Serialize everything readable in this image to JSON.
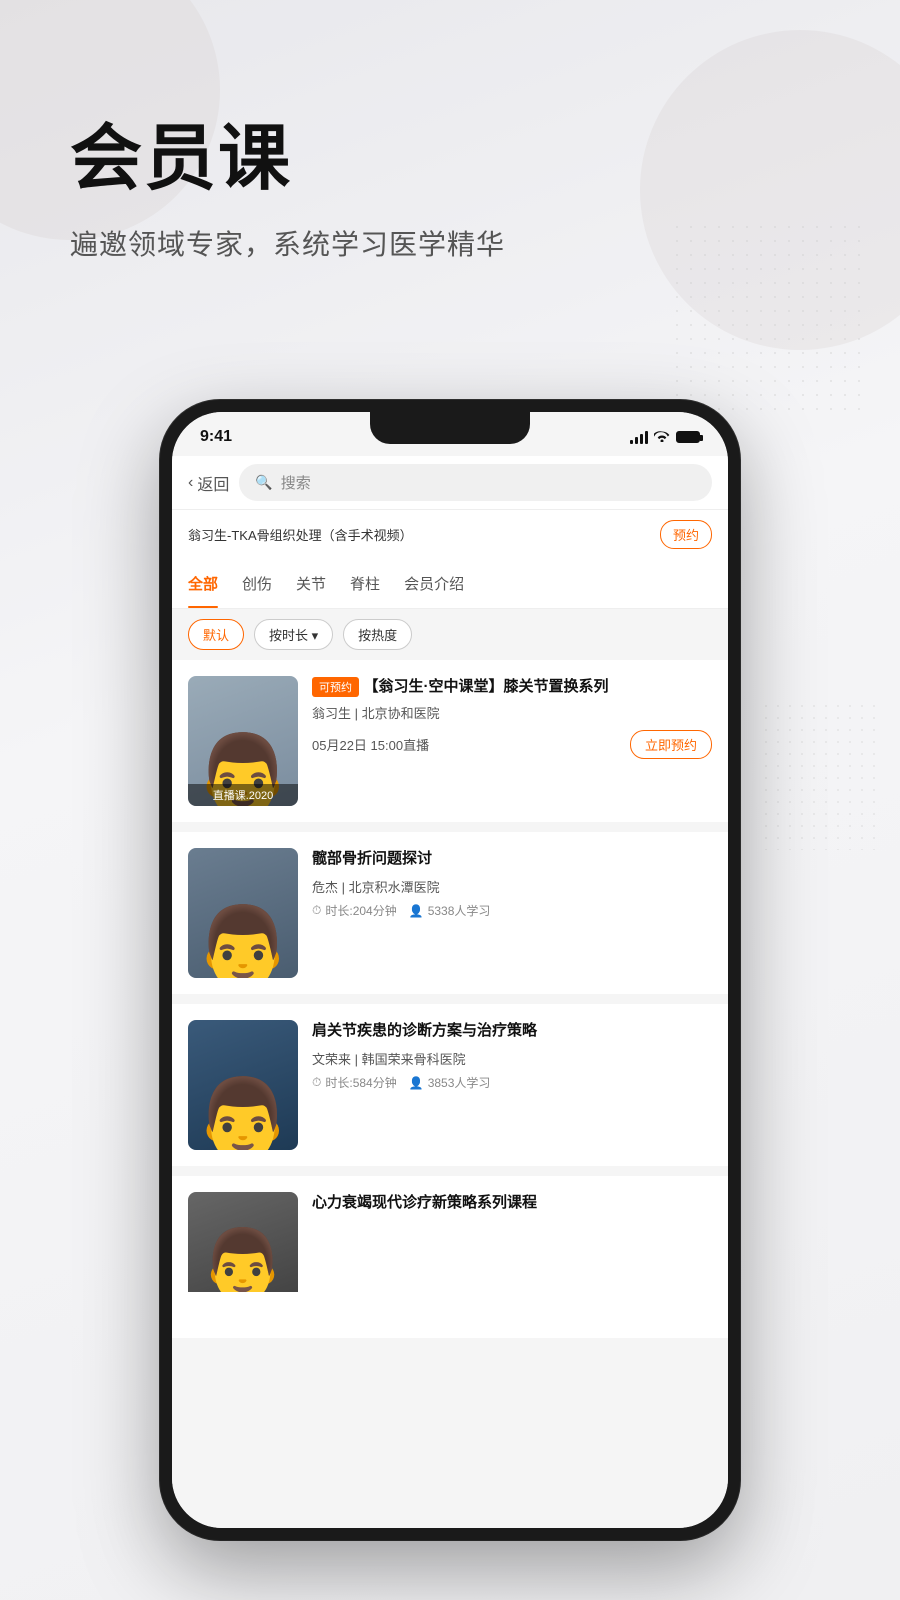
{
  "hero": {
    "title": "会员课",
    "subtitle": "遍邀领域专家，系统学习医学精华"
  },
  "status_bar": {
    "time": "9:41",
    "signal_label": "signal",
    "wifi_label": "wifi",
    "battery_label": "battery"
  },
  "nav": {
    "back_label": "返回",
    "search_placeholder": "搜索"
  },
  "course_info_bar": {
    "text": "翁习生-TKA骨组织处理（含手术视频）",
    "reserve_label": "预约"
  },
  "tabs": [
    {
      "label": "全部",
      "active": true
    },
    {
      "label": "创伤",
      "active": false
    },
    {
      "label": "关节",
      "active": false
    },
    {
      "label": "脊柱",
      "active": false
    },
    {
      "label": "会员介绍",
      "active": false
    }
  ],
  "filters": [
    {
      "label": "默认",
      "active": true
    },
    {
      "label": "按时长 ▾",
      "active": false
    },
    {
      "label": "按热度",
      "active": false
    }
  ],
  "courses": [
    {
      "id": 1,
      "badge": "可预约",
      "title": "【翁习生·空中课堂】膝关节置换系列",
      "doctor": "翁习生 | 北京协和医院",
      "thumb_bg": "#8a9bb0",
      "thumb_label": "直播课.2020",
      "is_live": true,
      "live_time": "05月22日 15:00直播",
      "action_label": "立即预约",
      "duration": null,
      "students": null
    },
    {
      "id": 2,
      "badge": null,
      "title": "髋部骨折问题探讨",
      "doctor": "危杰 | 北京积水潭医院",
      "thumb_bg": "#5a6a7d",
      "thumb_label": null,
      "is_live": false,
      "live_time": null,
      "action_label": null,
      "duration": "时长:204分钟",
      "students": "5338人学习"
    },
    {
      "id": 3,
      "badge": null,
      "title": "肩关节疾患的诊断方案与治疗策略",
      "doctor": "文荣来 | 韩国荣来骨科医院",
      "thumb_bg": "#2d4a6b",
      "thumb_label": null,
      "is_live": false,
      "live_time": null,
      "action_label": null,
      "duration": "时长:584分钟",
      "students": "3853人学习"
    },
    {
      "id": 4,
      "badge": null,
      "title": "心力衰竭现代诊疗新策略系列课程",
      "doctor": "",
      "thumb_bg": "#444",
      "thumb_label": null,
      "is_live": false,
      "live_time": null,
      "action_label": null,
      "duration": null,
      "students": null
    }
  ]
}
